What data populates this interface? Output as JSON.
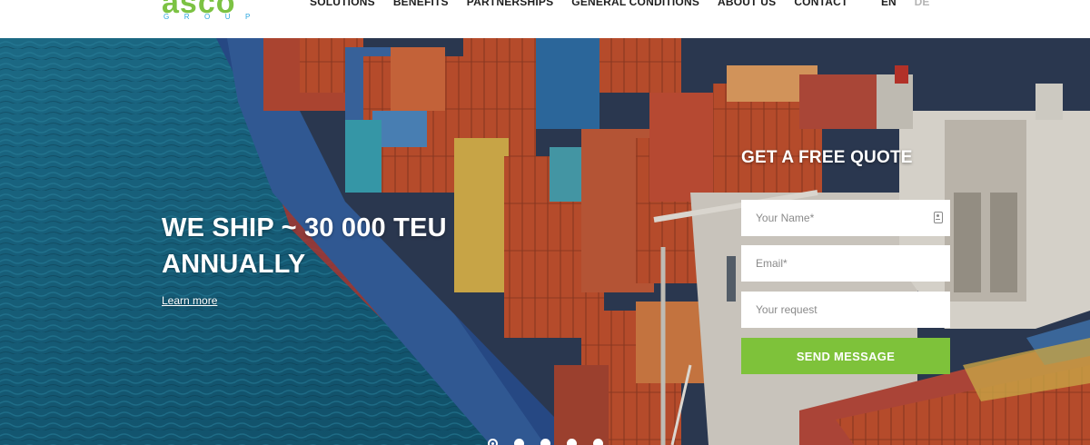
{
  "brand": {
    "logo_word": "asco",
    "logo_sub": "GROUP",
    "green": "#7cc243",
    "blue": "#2ba6de"
  },
  "nav": {
    "items": [
      {
        "label": "SOLUTIONS"
      },
      {
        "label": "BENEFITS"
      },
      {
        "label": "PARTNERSHIPS"
      },
      {
        "label": "GENERAL CONDITIONS"
      },
      {
        "label": "ABOUT US"
      },
      {
        "label": "CONTACT"
      }
    ]
  },
  "lang": {
    "en": "EN",
    "de": "DE",
    "selected": "EN"
  },
  "hero": {
    "headline_line1": "WE SHIP ~ 30 000 TEU",
    "headline_line2": "ANNUALLY",
    "learn_more": "Learn more",
    "slides": 5,
    "active_slide": 1
  },
  "quote": {
    "title": "GET A FREE QUOTE",
    "name_placeholder": "Your Name*",
    "email_placeholder": "Email*",
    "request_placeholder": "Your request",
    "send_label": "SEND MESSAGE",
    "button_color": "#7ec23a"
  }
}
